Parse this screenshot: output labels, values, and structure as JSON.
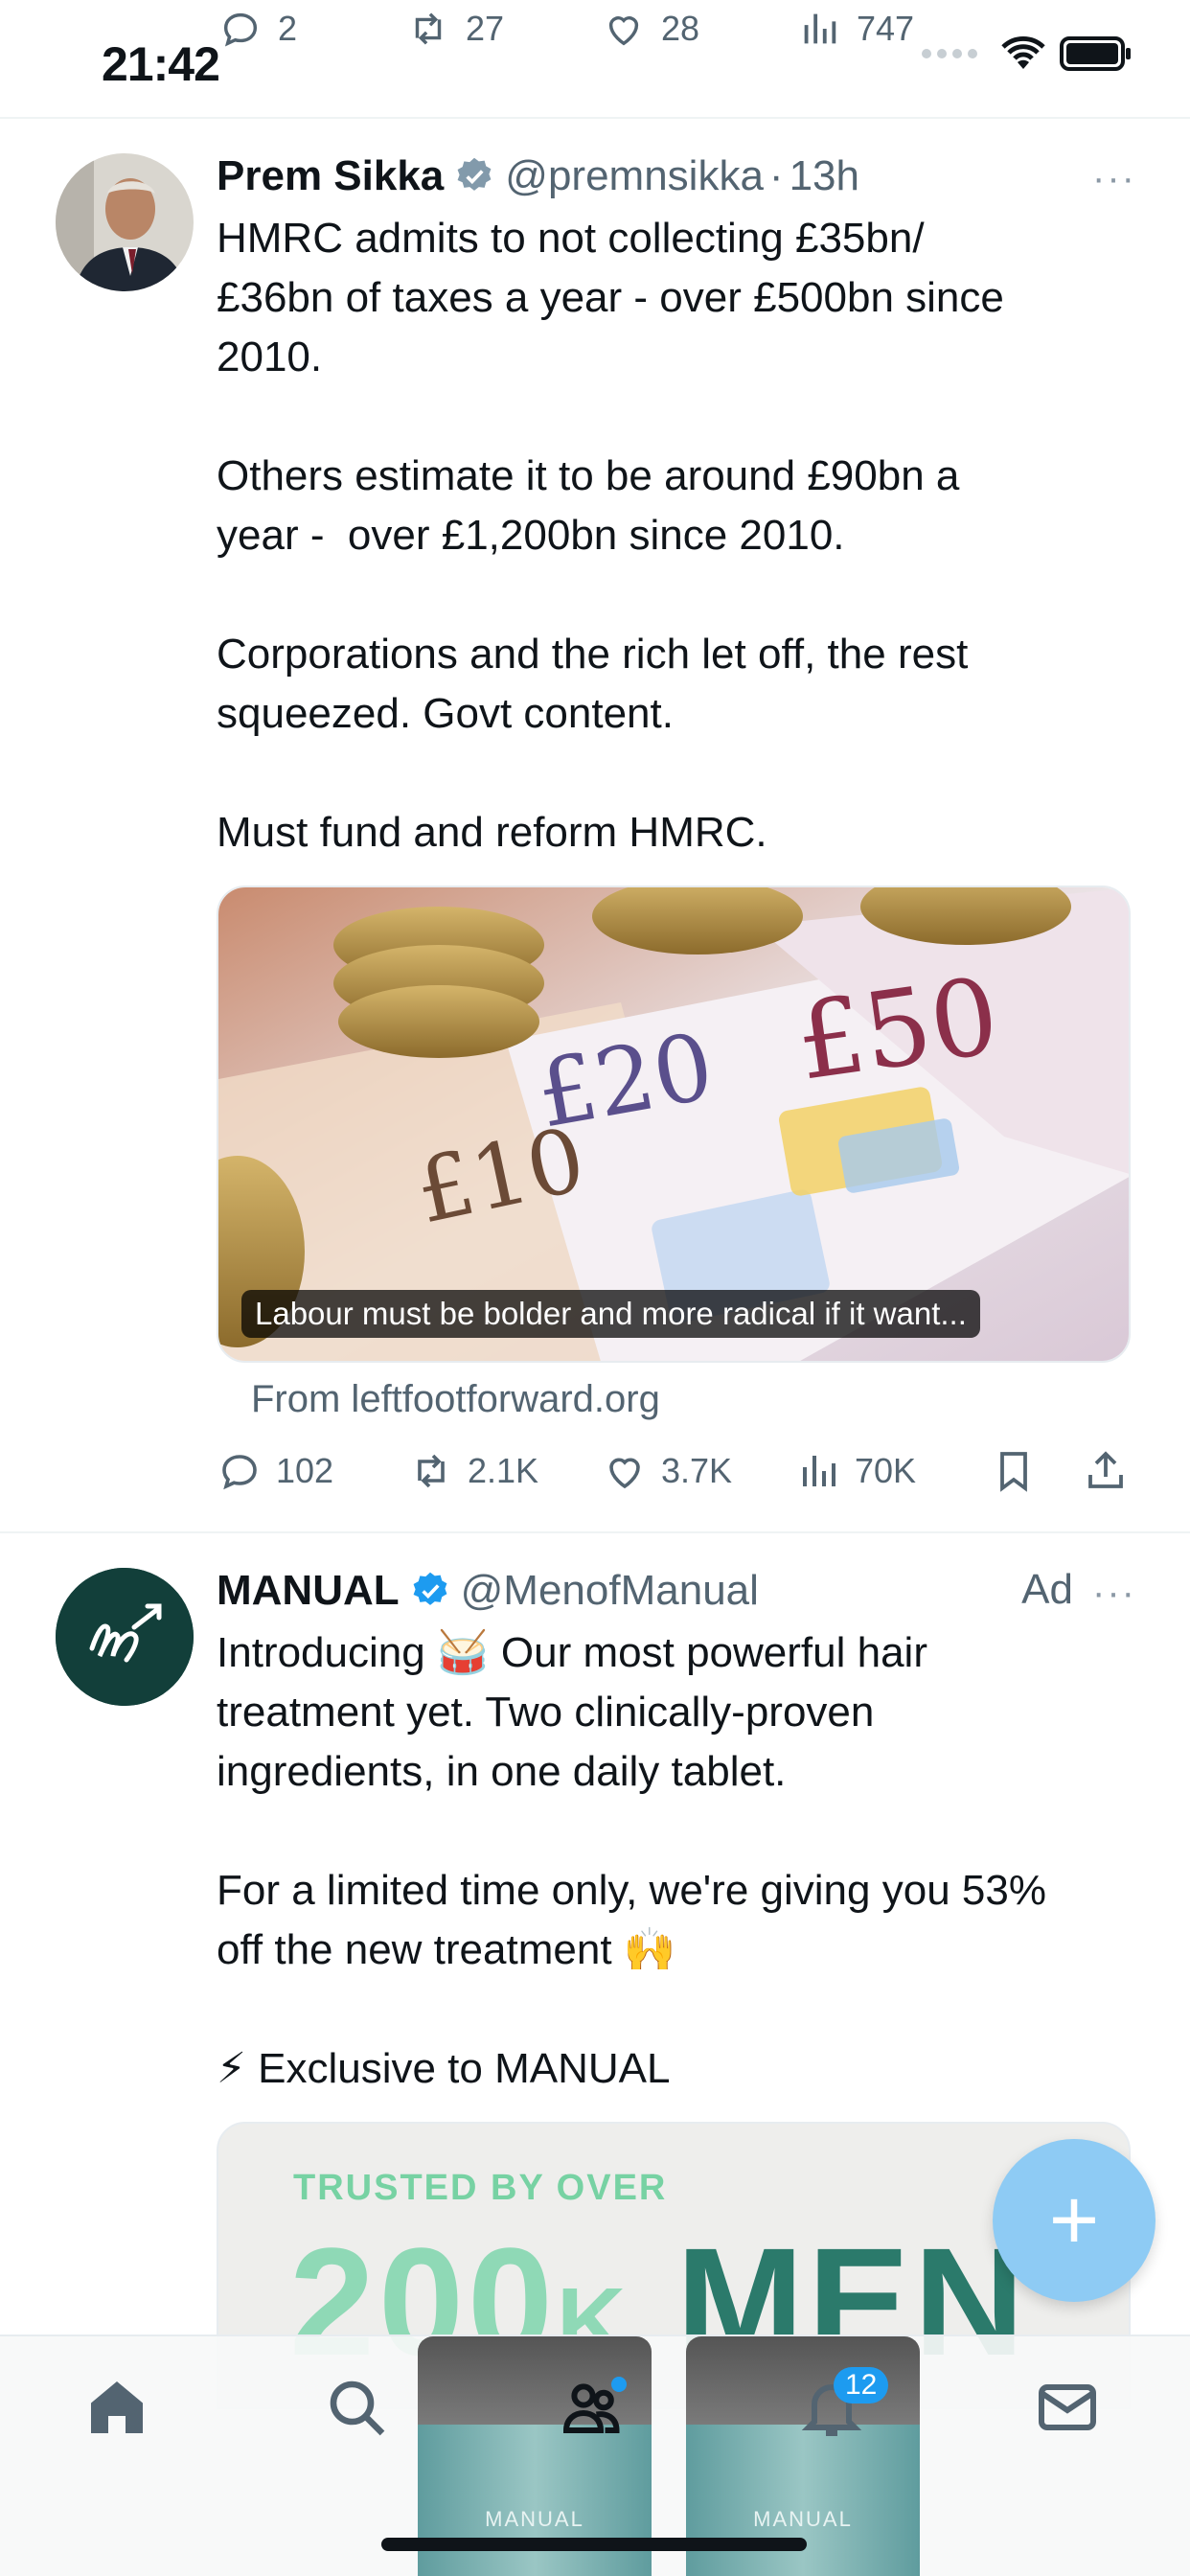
{
  "status_bar": {
    "time": "21:42"
  },
  "prev_tweet_metrics": {
    "replies": "2",
    "retweets": "27",
    "likes": "28",
    "views": "747"
  },
  "tweet1": {
    "name": "Prem Sikka",
    "handle": "@premnsikka",
    "separator": "·",
    "time": "13h",
    "more": "···",
    "text": "HMRC admits to not collecting £35bn/\n£36bn of taxes a year - over £500bn since\n2010.\n\nOthers estimate it to be around £90bn a\nyear -  over £1,200bn since 2010.\n\nCorporations and the rich let off, the rest\nsqueezed. Govt content.\n\nMust fund and reform HMRC.",
    "card_caption": "Labour must be bolder and more radical if it want...",
    "card_source": "From leftfootforward.org",
    "note_labels": {
      "n50": "£50",
      "n20": "£20",
      "n10": "£10"
    },
    "replies": "102",
    "retweets": "2.1K",
    "likes": "3.7K",
    "views": "70K"
  },
  "tweet2": {
    "name": "MANUAL",
    "handle": "@MenofManual",
    "ad_label": "Ad",
    "more": "···",
    "text_line1": "Introducing 🥁 Our most powerful hair\ntreatment yet. Two clinically-proven\ningredients, in one daily tablet.\n\nFor a limited time only, we're giving you 53%\noff the new treatment 🙌\n\n⚡ Exclusive to MANUAL",
    "card_trusted": "TRUSTED BY OVER",
    "card_big_num": "200",
    "card_big_k": "K",
    "card_big_men": "MEN",
    "product_brand": "MANUAL"
  },
  "fab": {
    "label": "+"
  },
  "bottom_nav": {
    "notifications_badge": "12"
  },
  "colors": {
    "accent": "#1d9bf0",
    "muted": "#536471",
    "fab": "#8ecbf4"
  }
}
